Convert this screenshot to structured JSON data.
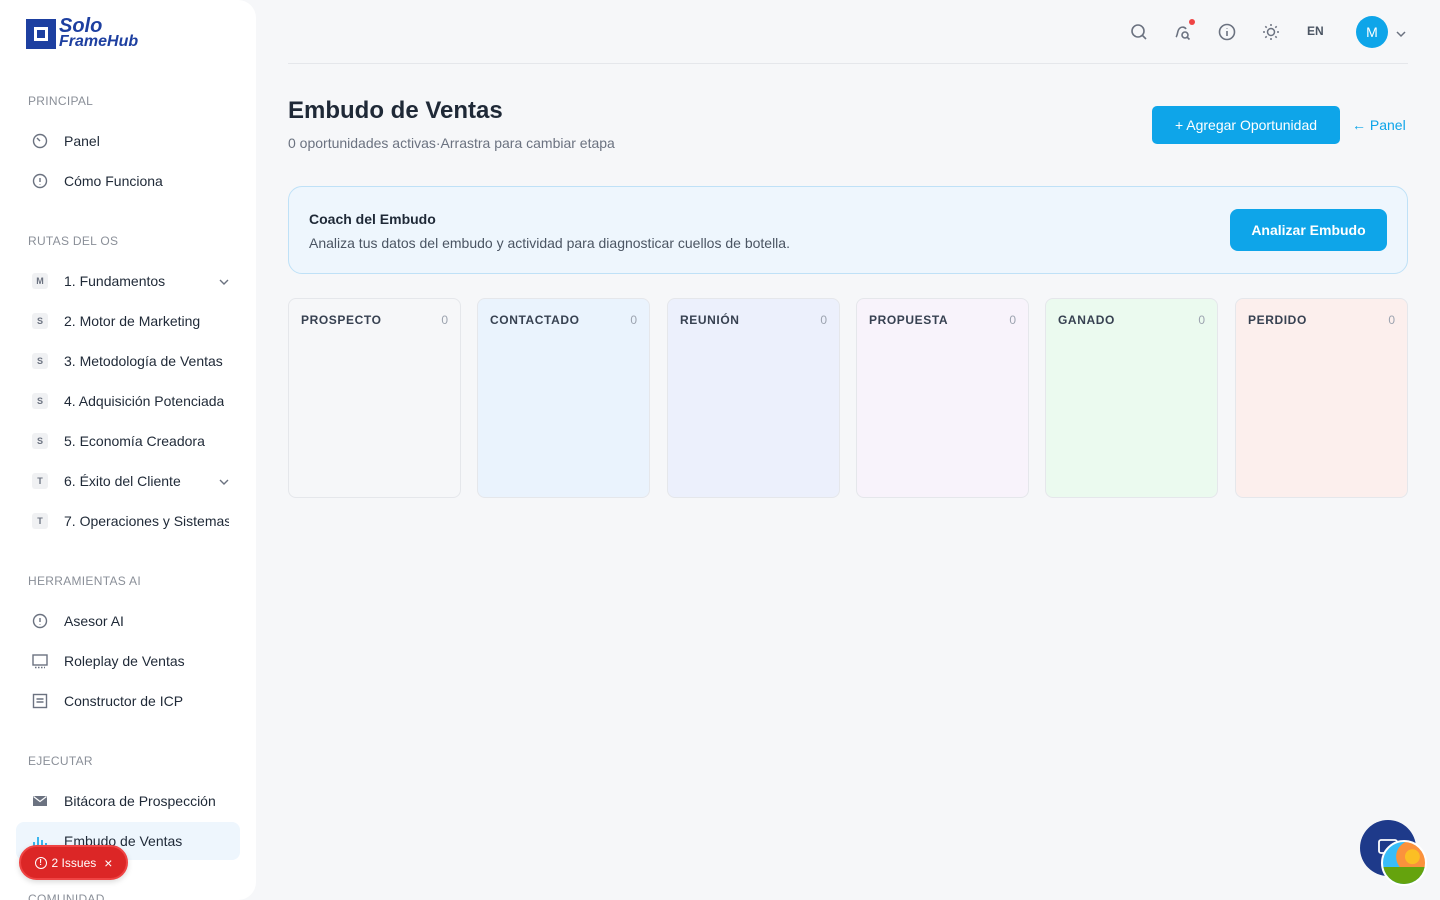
{
  "brand": {
    "line1": "Solo",
    "line2": "FrameHub"
  },
  "sidebar": {
    "sections": {
      "principal": "PRINCIPAL",
      "rutas": "RUTAS DEL OS",
      "herramientas": "HERRAMIENTAS AI",
      "ejecutar": "EJECUTAR",
      "comunidad": "COMUNIDAD"
    },
    "principal_items": [
      {
        "label": "Panel",
        "icon": "gauge-icon"
      },
      {
        "label": "Cómo Funciona",
        "icon": "info-icon"
      }
    ],
    "rutas_items": [
      {
        "badge": "M",
        "label": "1. Fundamentos"
      },
      {
        "badge": "S",
        "label": "2. Motor de Marketing"
      },
      {
        "badge": "S",
        "label": "3. Metodología de Ventas"
      },
      {
        "badge": "S",
        "label": "4. Adquisición Potenciada"
      },
      {
        "badge": "S",
        "label": "5. Economía Creadora"
      },
      {
        "badge": "T",
        "label": "6. Éxito del Cliente"
      },
      {
        "badge": "T",
        "label": "7. Operaciones y Sistemas"
      }
    ],
    "herramientas_items": [
      {
        "label": "Asesor AI",
        "icon": "info-icon"
      },
      {
        "label": "Roleplay de Ventas",
        "icon": "monitor-icon"
      },
      {
        "label": "Constructor de ICP",
        "icon": "document-icon"
      }
    ],
    "ejecutar_items": [
      {
        "label": "Bitácora de Prospección",
        "icon": "mail-icon"
      },
      {
        "label": "Embudo de Ventas",
        "icon": "chart-icon"
      }
    ]
  },
  "issues": {
    "label": "2 Issues"
  },
  "topbar": {
    "lang": "EN",
    "avatar_initial": "M"
  },
  "header": {
    "title": "Embudo de Ventas",
    "subtitle": "0 oportunidades activas·Arrastra para cambiar etapa",
    "add_button": "+ Agregar Oportunidad",
    "back_link": "← Panel"
  },
  "coach": {
    "title": "Coach del Embudo",
    "description": "Analiza tus datos del embudo y actividad para diagnosticar cuellos de botella.",
    "button": "Analizar Embudo"
  },
  "stages": [
    {
      "name": "PROSPECTO",
      "count": "0",
      "color": "#f6f7f9"
    },
    {
      "name": "CONTACTADO",
      "count": "0",
      "color": "#eaf3fd"
    },
    {
      "name": "REUNIÓN",
      "count": "0",
      "color": "#ecf0fc"
    },
    {
      "name": "PROPUESTA",
      "count": "0",
      "color": "#f8f3fb"
    },
    {
      "name": "GANADO",
      "count": "0",
      "color": "#ebfaef"
    },
    {
      "name": "PERDIDO",
      "count": "0",
      "color": "#fcefed"
    }
  ]
}
